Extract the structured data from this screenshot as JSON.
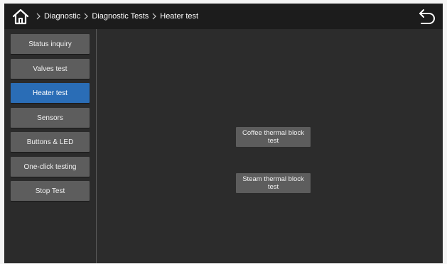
{
  "breadcrumb": {
    "items": [
      "Diagnostic",
      "Diagnostic Tests",
      "Heater test"
    ]
  },
  "icons": {
    "home": "home-icon",
    "back": "back-arrow-icon",
    "separator": "chevron-right-icon"
  },
  "sidebar": {
    "items": [
      {
        "label": "Status inquiry",
        "active": false
      },
      {
        "label": "Valves test",
        "active": false
      },
      {
        "label": "Heater test",
        "active": true
      },
      {
        "label": "Sensors",
        "active": false
      },
      {
        "label": "Buttons & LED",
        "active": false
      },
      {
        "label": "One-click testing",
        "active": false
      },
      {
        "label": "Stop Test",
        "active": false
      }
    ]
  },
  "main": {
    "buttons": [
      {
        "label": "Coffee thermal block\ntest"
      },
      {
        "label": "Steam thermal block\ntest"
      }
    ]
  },
  "colors": {
    "background": "#2c2c2c",
    "topbar": "#1c1c1c",
    "button": "#5d5d5d",
    "active": "#2a6db6"
  }
}
